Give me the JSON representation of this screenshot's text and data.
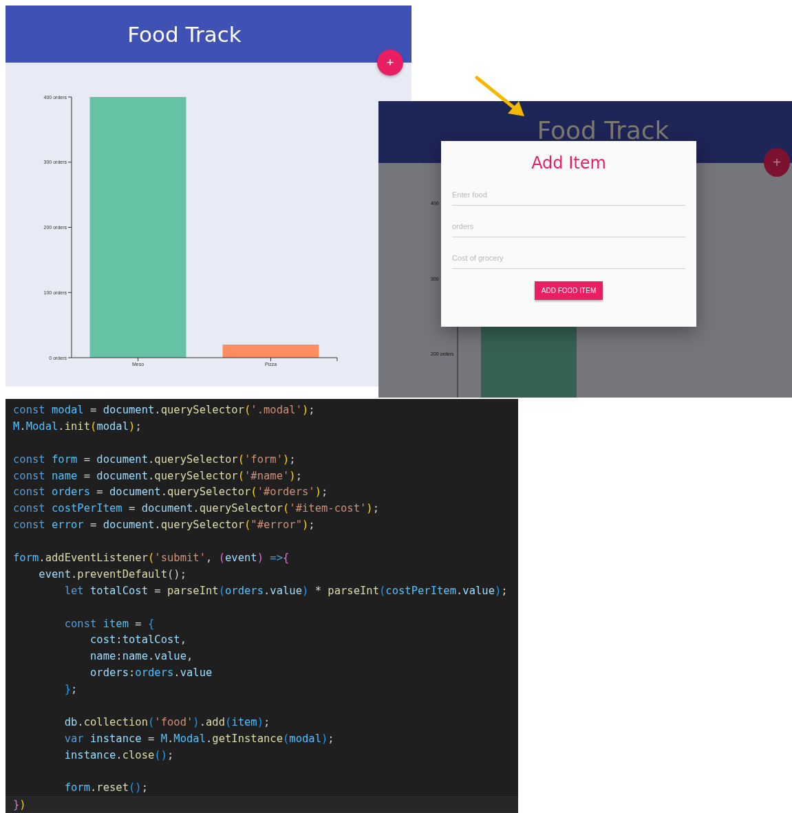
{
  "app_view": {
    "header": {
      "title": "Food Track"
    },
    "add_button": {
      "label": "+"
    },
    "chart_data": {
      "type": "bar",
      "categories": [
        "Meso",
        "Pizza"
      ],
      "stacked": true,
      "ylim": [
        0,
        400
      ],
      "yticks": [
        {
          "value": 0,
          "label": "0 orders"
        },
        {
          "value": 100,
          "label": "100 orders"
        },
        {
          "value": 200,
          "label": "200 orders"
        },
        {
          "value": 300,
          "label": "300 orders"
        },
        {
          "value": 400,
          "label": "400 orders"
        }
      ],
      "series": [
        {
          "color": "#66c2a5",
          "values": [
            400,
            null
          ]
        },
        {
          "color": "#fc8d62",
          "values": [
            null,
            20
          ]
        }
      ]
    }
  },
  "modal_view": {
    "header": {
      "title": "Food Track"
    },
    "add_button": {
      "label": "+"
    },
    "background_chart": {
      "tick_labels": [
        "400",
        "300",
        "200 orders"
      ]
    },
    "modal": {
      "title": "Add Item",
      "fields": [
        {
          "placeholder": "Enter food"
        },
        {
          "placeholder": "orders"
        },
        {
          "placeholder": "Cost of grocery"
        }
      ],
      "submit_button": "ADD FOOD ITEM"
    }
  },
  "code_editor": {
    "lines": [
      {
        "current": false,
        "tokens": [
          {
            "kind": "keyword",
            "t": "const "
          },
          {
            "kind": "variable",
            "t": "modal"
          },
          {
            "kind": "plain",
            "t": " = "
          },
          {
            "kind": "property",
            "t": "document"
          },
          {
            "kind": "plain",
            "t": "."
          },
          {
            "kind": "function",
            "t": "querySelector"
          },
          {
            "kind": "bracket1",
            "t": "("
          },
          {
            "kind": "string",
            "t": "'.modal'"
          },
          {
            "kind": "bracket1",
            "t": ")"
          },
          {
            "kind": "plain",
            "t": ";"
          }
        ]
      },
      {
        "current": false,
        "tokens": [
          {
            "kind": "variable",
            "t": "M"
          },
          {
            "kind": "plain",
            "t": "."
          },
          {
            "kind": "variable",
            "t": "Modal"
          },
          {
            "kind": "plain",
            "t": "."
          },
          {
            "kind": "function",
            "t": "init"
          },
          {
            "kind": "bracket1",
            "t": "("
          },
          {
            "kind": "property",
            "t": "modal"
          },
          {
            "kind": "bracket1",
            "t": ")"
          },
          {
            "kind": "plain",
            "t": ";"
          }
        ]
      },
      {
        "current": false
      },
      {
        "current": false,
        "tokens": [
          {
            "kind": "keyword",
            "t": "const "
          },
          {
            "kind": "variable",
            "t": "form"
          },
          {
            "kind": "plain",
            "t": " = "
          },
          {
            "kind": "property",
            "t": "document"
          },
          {
            "kind": "plain",
            "t": "."
          },
          {
            "kind": "function",
            "t": "querySelector"
          },
          {
            "kind": "bracket1",
            "t": "("
          },
          {
            "kind": "string",
            "t": "'form'"
          },
          {
            "kind": "bracket1",
            "t": ")"
          },
          {
            "kind": "plain",
            "t": ";"
          }
        ]
      },
      {
        "current": false,
        "tokens": [
          {
            "kind": "keyword",
            "t": "const "
          },
          {
            "kind": "variable",
            "t": "name"
          },
          {
            "kind": "plain",
            "t": " = "
          },
          {
            "kind": "property",
            "t": "document"
          },
          {
            "kind": "plain",
            "t": "."
          },
          {
            "kind": "function",
            "t": "querySelector"
          },
          {
            "kind": "bracket1",
            "t": "("
          },
          {
            "kind": "string",
            "t": "'#name'"
          },
          {
            "kind": "bracket1",
            "t": ")"
          },
          {
            "kind": "plain",
            "t": ";"
          }
        ]
      },
      {
        "current": false,
        "tokens": [
          {
            "kind": "keyword",
            "t": "const "
          },
          {
            "kind": "variable",
            "t": "orders"
          },
          {
            "kind": "plain",
            "t": " = "
          },
          {
            "kind": "property",
            "t": "document"
          },
          {
            "kind": "plain",
            "t": "."
          },
          {
            "kind": "function",
            "t": "querySelector"
          },
          {
            "kind": "bracket1",
            "t": "("
          },
          {
            "kind": "string",
            "t": "'#orders'"
          },
          {
            "kind": "bracket1",
            "t": ")"
          },
          {
            "kind": "plain",
            "t": ";"
          }
        ]
      },
      {
        "current": false,
        "tokens": [
          {
            "kind": "keyword",
            "t": "const "
          },
          {
            "kind": "variable",
            "t": "costPerItem"
          },
          {
            "kind": "plain",
            "t": " = "
          },
          {
            "kind": "property",
            "t": "document"
          },
          {
            "kind": "plain",
            "t": "."
          },
          {
            "kind": "function",
            "t": "querySelector"
          },
          {
            "kind": "bracket1",
            "t": "("
          },
          {
            "kind": "string",
            "t": "'#item-cost'"
          },
          {
            "kind": "bracket1",
            "t": ")"
          },
          {
            "kind": "plain",
            "t": ";"
          }
        ]
      },
      {
        "current": false,
        "tokens": [
          {
            "kind": "keyword",
            "t": "const "
          },
          {
            "kind": "variable",
            "t": "error"
          },
          {
            "kind": "plain",
            "t": " = "
          },
          {
            "kind": "property",
            "t": "document"
          },
          {
            "kind": "plain",
            "t": "."
          },
          {
            "kind": "function",
            "t": "querySelector"
          },
          {
            "kind": "bracket1",
            "t": "("
          },
          {
            "kind": "string",
            "t": "\"#error\""
          },
          {
            "kind": "bracket1",
            "t": ")"
          },
          {
            "kind": "plain",
            "t": ";"
          }
        ]
      },
      {
        "current": false
      },
      {
        "current": false,
        "tokens": [
          {
            "kind": "variable",
            "t": "form"
          },
          {
            "kind": "plain",
            "t": "."
          },
          {
            "kind": "function",
            "t": "addEventListener"
          },
          {
            "kind": "bracket1",
            "t": "("
          },
          {
            "kind": "string",
            "t": "'submit'"
          },
          {
            "kind": "plain",
            "t": ", "
          },
          {
            "kind": "bracket2",
            "t": "("
          },
          {
            "kind": "property",
            "t": "event"
          },
          {
            "kind": "bracket2",
            "t": ")"
          },
          {
            "kind": "keyword",
            "t": " =>"
          },
          {
            "kind": "bracket2",
            "t": "{"
          }
        ]
      },
      {
        "current": false,
        "tokens": [
          {
            "kind": "property",
            "t": "    event"
          },
          {
            "kind": "plain",
            "t": "."
          },
          {
            "kind": "function",
            "t": "preventDefault"
          },
          {
            "kind": "plain",
            "t": "();"
          }
        ]
      },
      {
        "current": false,
        "tokens": [
          {
            "kind": "keyword",
            "t": "        let "
          },
          {
            "kind": "property",
            "t": "totalCost"
          },
          {
            "kind": "plain",
            "t": " = "
          },
          {
            "kind": "function",
            "t": "parseInt"
          },
          {
            "kind": "bracket3",
            "t": "("
          },
          {
            "kind": "variable",
            "t": "orders"
          },
          {
            "kind": "plain",
            "t": "."
          },
          {
            "kind": "property",
            "t": "value"
          },
          {
            "kind": "bracket3",
            "t": ")"
          },
          {
            "kind": "plain",
            "t": " * "
          },
          {
            "kind": "function",
            "t": "parseInt"
          },
          {
            "kind": "bracket3",
            "t": "("
          },
          {
            "kind": "variable",
            "t": "costPerItem"
          },
          {
            "kind": "plain",
            "t": "."
          },
          {
            "kind": "property",
            "t": "value"
          },
          {
            "kind": "bracket3",
            "t": ")"
          },
          {
            "kind": "plain",
            "t": ";"
          }
        ]
      },
      {
        "current": false
      },
      {
        "current": false,
        "tokens": [
          {
            "kind": "keyword",
            "t": "        const "
          },
          {
            "kind": "variable",
            "t": "item"
          },
          {
            "kind": "plain",
            "t": " = "
          },
          {
            "kind": "bracket3",
            "t": "{"
          }
        ]
      },
      {
        "current": false,
        "tokens": [
          {
            "kind": "property",
            "t": "            cost"
          },
          {
            "kind": "plain",
            "t": ":"
          },
          {
            "kind": "property",
            "t": "totalCost"
          },
          {
            "kind": "plain",
            "t": ","
          }
        ]
      },
      {
        "current": false,
        "tokens": [
          {
            "kind": "property",
            "t": "            name"
          },
          {
            "kind": "plain",
            "t": ":"
          },
          {
            "kind": "property",
            "t": "name"
          },
          {
            "kind": "plain",
            "t": "."
          },
          {
            "kind": "property",
            "t": "value"
          },
          {
            "kind": "plain",
            "t": ","
          }
        ]
      },
      {
        "current": false,
        "tokens": [
          {
            "kind": "property",
            "t": "            orders"
          },
          {
            "kind": "plain",
            "t": ":"
          },
          {
            "kind": "variable",
            "t": "orders"
          },
          {
            "kind": "plain",
            "t": "."
          },
          {
            "kind": "property",
            "t": "value"
          }
        ]
      },
      {
        "current": false,
        "tokens": [
          {
            "kind": "bracket3",
            "t": "        }"
          },
          {
            "kind": "plain",
            "t": ";"
          }
        ]
      },
      {
        "current": false
      },
      {
        "current": false,
        "tokens": [
          {
            "kind": "property",
            "t": "        db"
          },
          {
            "kind": "plain",
            "t": "."
          },
          {
            "kind": "function",
            "t": "collection"
          },
          {
            "kind": "bracket3",
            "t": "("
          },
          {
            "kind": "string",
            "t": "'food'"
          },
          {
            "kind": "bracket3",
            "t": ")"
          },
          {
            "kind": "plain",
            "t": "."
          },
          {
            "kind": "function",
            "t": "add"
          },
          {
            "kind": "bracket3",
            "t": "("
          },
          {
            "kind": "variable",
            "t": "item"
          },
          {
            "kind": "bracket3",
            "t": ")"
          },
          {
            "kind": "plain",
            "t": ";"
          }
        ]
      },
      {
        "current": false,
        "tokens": [
          {
            "kind": "keyword",
            "t": "        var "
          },
          {
            "kind": "property",
            "t": "instance"
          },
          {
            "kind": "plain",
            "t": " = "
          },
          {
            "kind": "variable",
            "t": "M"
          },
          {
            "kind": "plain",
            "t": "."
          },
          {
            "kind": "variable",
            "t": "Modal"
          },
          {
            "kind": "plain",
            "t": "."
          },
          {
            "kind": "function",
            "t": "getInstance"
          },
          {
            "kind": "bracket3",
            "t": "("
          },
          {
            "kind": "variable",
            "t": "modal"
          },
          {
            "kind": "bracket3",
            "t": ")"
          },
          {
            "kind": "plain",
            "t": ";"
          }
        ]
      },
      {
        "current": false,
        "tokens": [
          {
            "kind": "property",
            "t": "        instance"
          },
          {
            "kind": "plain",
            "t": "."
          },
          {
            "kind": "function",
            "t": "close"
          },
          {
            "kind": "bracket3",
            "t": "()"
          },
          {
            "kind": "plain",
            "t": ";"
          }
        ]
      },
      {
        "current": false
      },
      {
        "current": false,
        "tokens": [
          {
            "kind": "variable",
            "t": "        form"
          },
          {
            "kind": "plain",
            "t": "."
          },
          {
            "kind": "function",
            "t": "reset"
          },
          {
            "kind": "bracket3",
            "t": "()"
          },
          {
            "kind": "plain",
            "t": ";"
          }
        ]
      },
      {
        "current": true,
        "tokens": [
          {
            "kind": "bracket2",
            "t": "}"
          },
          {
            "kind": "bracket1",
            "t": ")"
          }
        ]
      }
    ]
  }
}
